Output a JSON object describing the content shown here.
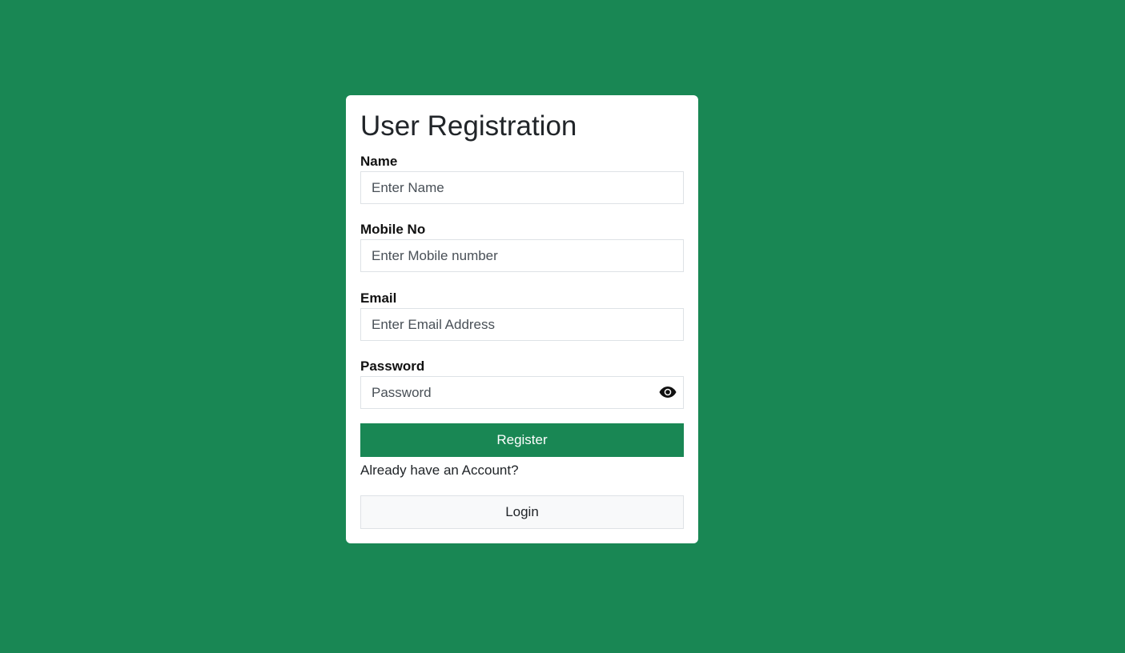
{
  "form": {
    "title": "User Registration",
    "fields": [
      {
        "label": "Name",
        "placeholder": "Enter Name",
        "value": ""
      },
      {
        "label": "Mobile No",
        "placeholder": "Enter Mobile number",
        "value": ""
      },
      {
        "label": "Email",
        "placeholder": "Enter Email Address",
        "value": ""
      },
      {
        "label": "Password",
        "placeholder": "Password",
        "value": ""
      }
    ],
    "password_toggle_icon": "eye-icon",
    "register_label": "Register",
    "already_text": "Already have an Account?",
    "login_label": "Login"
  },
  "colors": {
    "background": "#198754",
    "accent": "#198754"
  }
}
